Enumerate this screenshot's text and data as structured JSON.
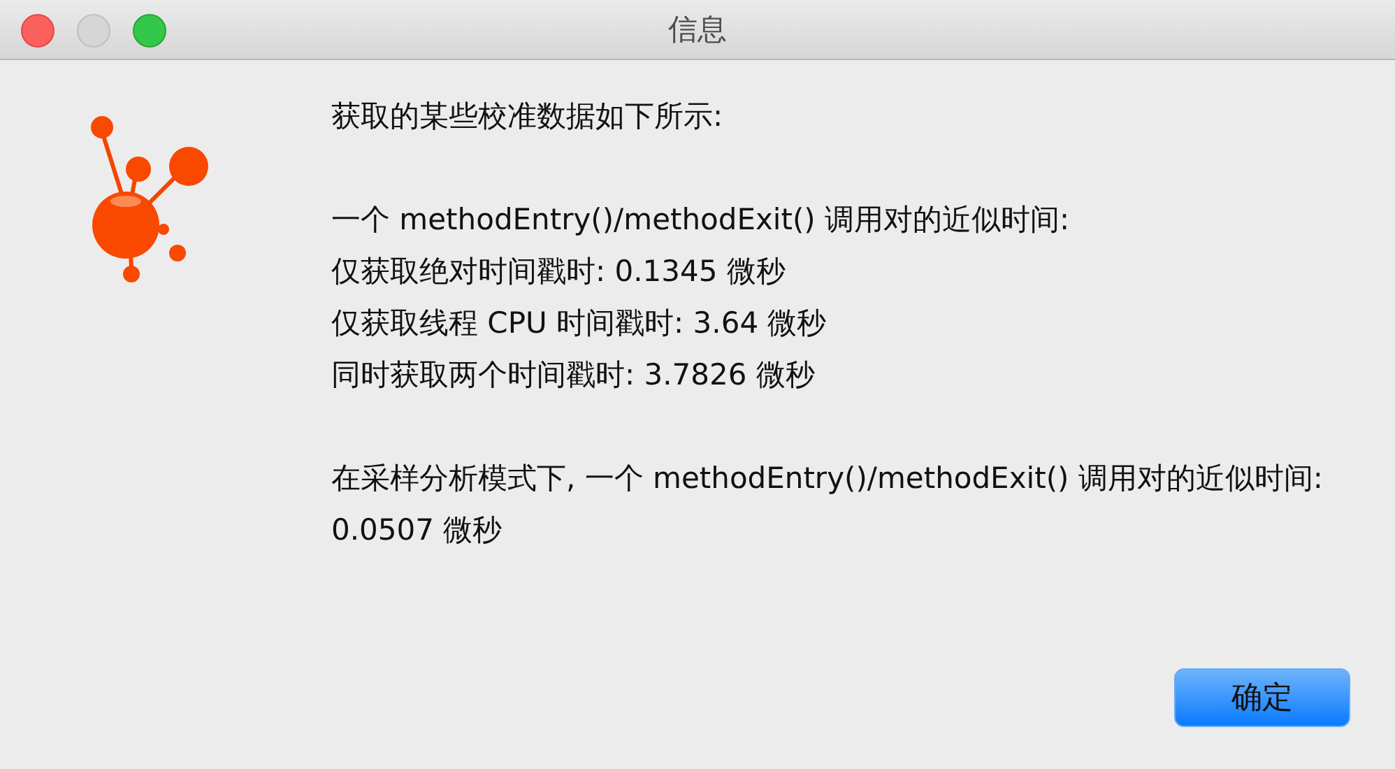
{
  "window": {
    "title": "信息"
  },
  "message": {
    "paragraphs": [
      [
        "获取的某些校准数据如下所示:"
      ],
      [
        "一个 methodEntry()/methodExit() 调用对的近似时间:",
        "仅获取绝对时间戳时: 0.1345 微秒",
        "仅获取线程 CPU 时间戳时: 3.64 微秒",
        "同时获取两个时间戳时: 3.7826 微秒"
      ],
      [
        "在采样分析模式下, 一个 methodEntry()/methodExit() 调用对的近似时间: 0.0507 微秒"
      ]
    ]
  },
  "buttons": [
    {
      "label": "确定",
      "default": true
    }
  ]
}
